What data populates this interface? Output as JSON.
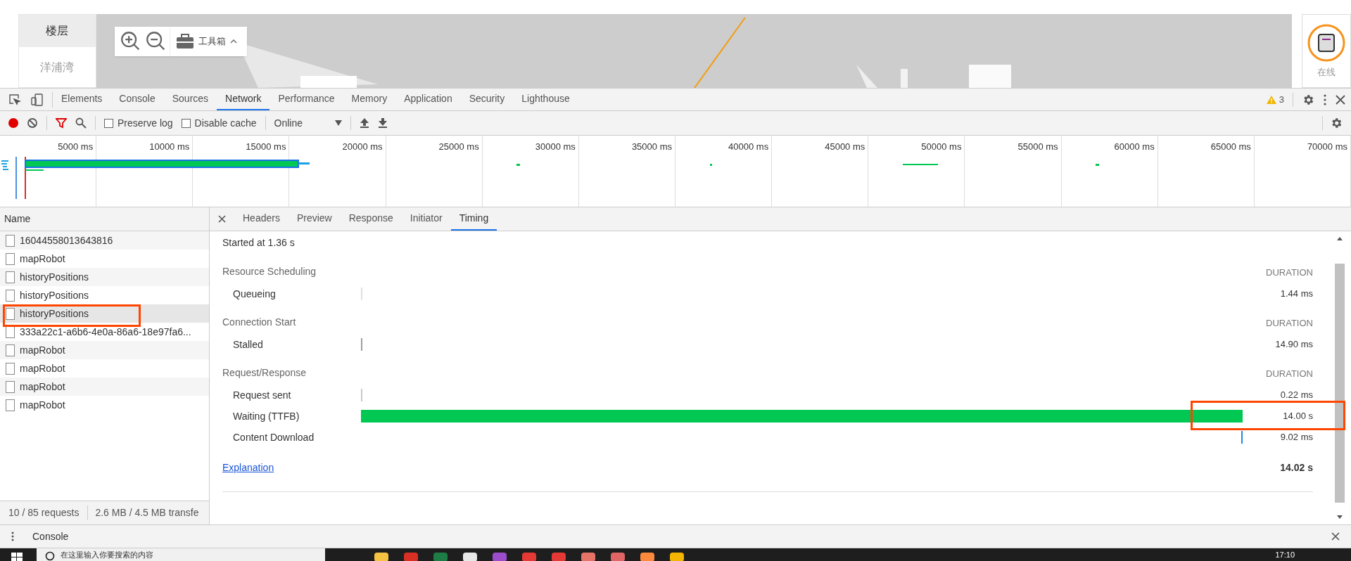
{
  "page": {
    "floor_header": "楼层",
    "floor_item": "洋浦湾",
    "toolbox": "工具箱",
    "robot_status": "在线"
  },
  "devtools": {
    "tabs": [
      {
        "label": "Elements",
        "selected": false
      },
      {
        "label": "Console",
        "selected": false
      },
      {
        "label": "Sources",
        "selected": false
      },
      {
        "label": "Network",
        "selected": true
      },
      {
        "label": "Performance",
        "selected": false
      },
      {
        "label": "Memory",
        "selected": false
      },
      {
        "label": "Application",
        "selected": false
      },
      {
        "label": "Security",
        "selected": false
      },
      {
        "label": "Lighthouse",
        "selected": false
      }
    ],
    "warnings": "3"
  },
  "toolbar": {
    "recording": true,
    "options": [
      {
        "label": "Preserve log",
        "checked": false
      },
      {
        "label": "Disable cache",
        "checked": false
      }
    ],
    "throttling": "Online"
  },
  "timeline": {
    "ticks": [
      "5000 ms",
      "10000 ms",
      "15000 ms",
      "20000 ms",
      "25000 ms",
      "30000 ms",
      "35000 ms",
      "40000 ms",
      "45000 ms",
      "50000 ms",
      "55000 ms",
      "60000 ms",
      "65000 ms",
      "70000 ms"
    ]
  },
  "requests": {
    "column": "Name",
    "rows": [
      {
        "name": "16044558013643816",
        "selected": false
      },
      {
        "name": "mapRobot",
        "selected": false
      },
      {
        "name": "historyPositions",
        "selected": false
      },
      {
        "name": "historyPositions",
        "selected": false
      },
      {
        "name": "historyPositions",
        "selected": true
      },
      {
        "name": "333a22c1-a6b6-4e0a-86a6-18e97fa6...",
        "selected": false
      },
      {
        "name": "mapRobot",
        "selected": false
      },
      {
        "name": "mapRobot",
        "selected": false
      },
      {
        "name": "mapRobot",
        "selected": false
      },
      {
        "name": "mapRobot",
        "selected": false
      }
    ],
    "status": [
      "10 / 85 requests",
      "2.6 MB / 4.5 MB transfe"
    ]
  },
  "detail_tabs": [
    {
      "label": "Headers",
      "selected": false
    },
    {
      "label": "Preview",
      "selected": false
    },
    {
      "label": "Response",
      "selected": false
    },
    {
      "label": "Initiator",
      "selected": false
    },
    {
      "label": "Timing",
      "selected": true
    }
  ],
  "timing": {
    "started": "Started at 1.36 s",
    "sections": [
      {
        "title": "Resource Scheduling",
        "duration_label": "DURATION",
        "phases": [
          {
            "name": "Queueing",
            "duration": "1.44 ms",
            "kind": "tick",
            "color": "#e0e0e0"
          }
        ]
      },
      {
        "title": "Connection Start",
        "duration_label": "DURATION",
        "phases": [
          {
            "name": "Stalled",
            "duration": "14.90 ms",
            "kind": "tick",
            "color": "#9e9e9e"
          }
        ]
      },
      {
        "title": "Request/Response",
        "duration_label": "DURATION",
        "phases": [
          {
            "name": "Request sent",
            "duration": "0.22 ms",
            "kind": "tick",
            "color": "#c8c8c8"
          },
          {
            "name": "Waiting (TTFB)",
            "duration": "14.00 s",
            "kind": "bar",
            "color": "#00c853"
          },
          {
            "name": "Content Download",
            "duration": "9.02 ms",
            "kind": "tick",
            "color": "#1e88e5"
          }
        ]
      }
    ],
    "explanation": "Explanation",
    "total": "14.02 s"
  },
  "drawer": {
    "title": "Console"
  },
  "taskbar": {
    "search": "在这里输入你要搜索的内容",
    "time": "17:10"
  }
}
